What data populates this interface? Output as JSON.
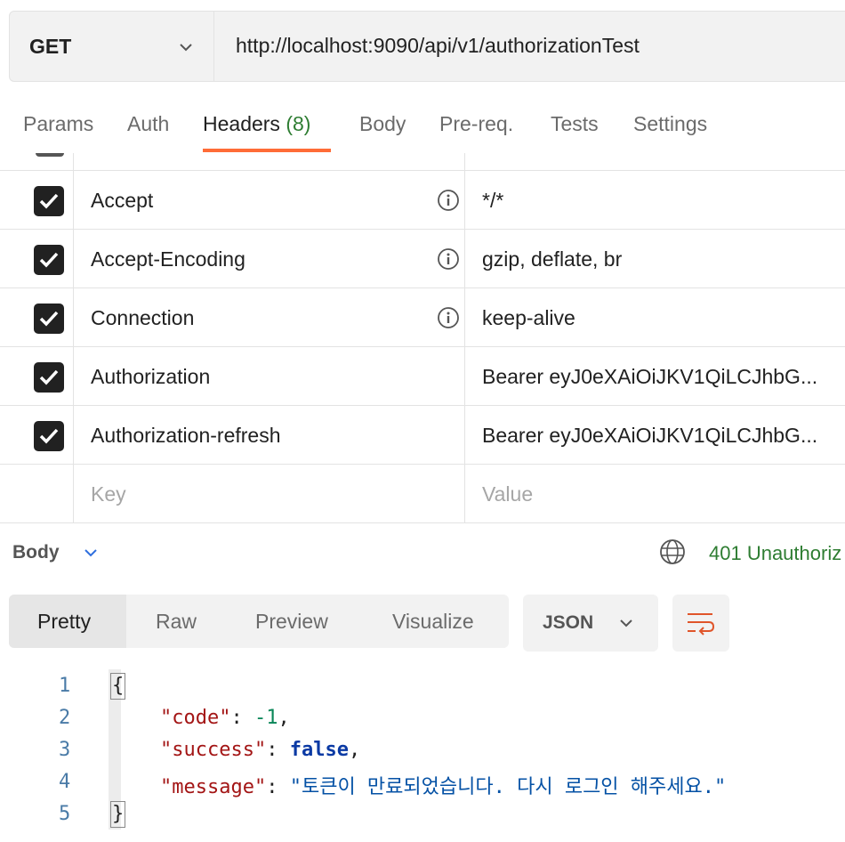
{
  "request": {
    "method": "GET",
    "url": "http://localhost:9090/api/v1/authorizationTest"
  },
  "tabs": [
    {
      "label": "Params"
    },
    {
      "label": "Auth"
    },
    {
      "label": "Headers",
      "count": "(8)"
    },
    {
      "label": "Body"
    },
    {
      "label": "Pre-req."
    },
    {
      "label": "Tests"
    },
    {
      "label": "Settings"
    }
  ],
  "headers": [
    {
      "key": "Accept",
      "value": "*/*",
      "checked": true,
      "info": true
    },
    {
      "key": "Accept-Encoding",
      "value": "gzip, deflate, br",
      "checked": true,
      "info": true
    },
    {
      "key": "Connection",
      "value": "keep-alive",
      "checked": true,
      "info": true
    },
    {
      "key": "Authorization",
      "value": "Bearer eyJ0eXAiOiJKV1QiLCJhbG...",
      "checked": true,
      "info": false
    },
    {
      "key": "Authorization-refresh",
      "value": "Bearer eyJ0eXAiOiJKV1QiLCJhbG...",
      "checked": true,
      "info": false
    }
  ],
  "new_row": {
    "key_placeholder": "Key",
    "value_placeholder": "Value"
  },
  "response": {
    "section_label": "Body",
    "status": "401 Unauthoriz",
    "status_color": "#2e7d32",
    "views": [
      "Pretty",
      "Raw",
      "Preview",
      "Visualize"
    ],
    "active_view": "Pretty",
    "format": "JSON",
    "line_numbers": [
      "1",
      "2",
      "3",
      "4",
      "5"
    ],
    "json": {
      "open": "{",
      "close": "}",
      "code_key": "\"code\"",
      "code_value": "-1",
      "success_key": "\"success\"",
      "success_value": "false",
      "message_key": "\"message\"",
      "message_value": "\"토큰이 만료되었습니다. 다시 로그인 해주세요.\""
    }
  },
  "colors": {
    "accent": "#ff6c37",
    "status_ok_text": "#2e7d32"
  }
}
